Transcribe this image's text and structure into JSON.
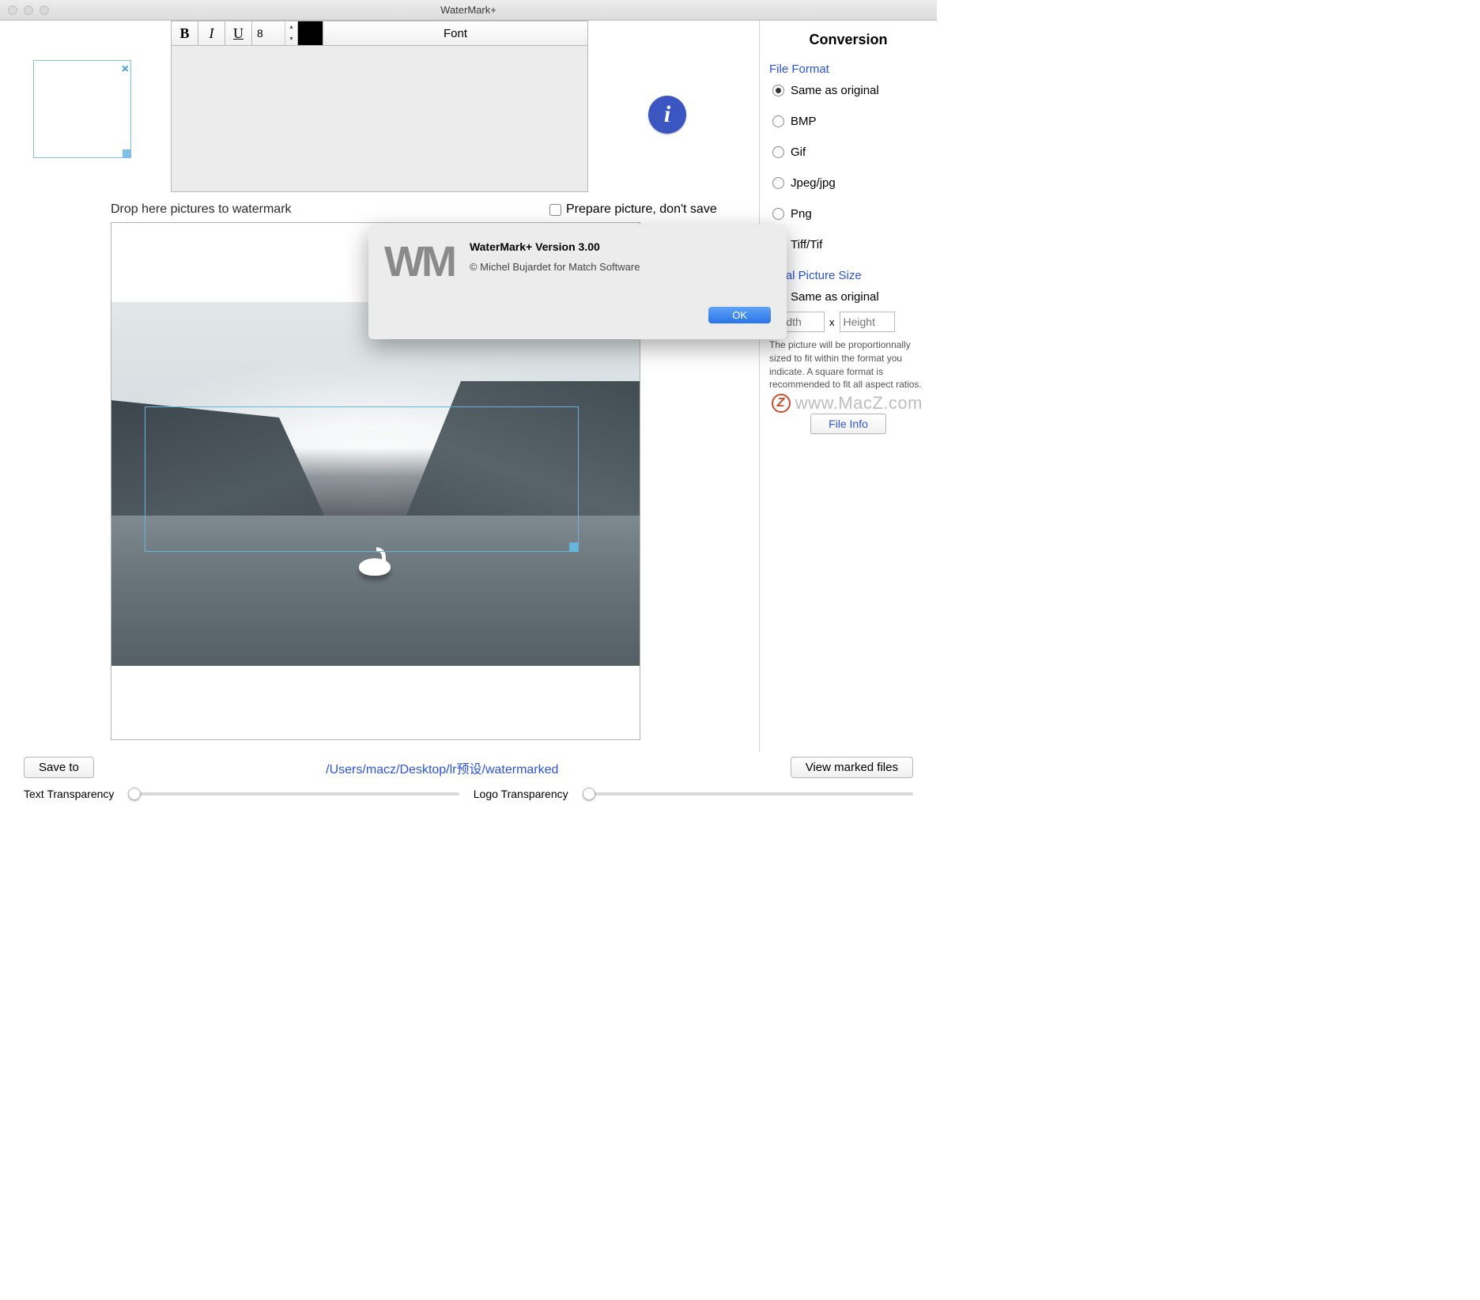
{
  "window": {
    "title": "WaterMark+"
  },
  "toolbar": {
    "bold": "B",
    "italic": "I",
    "underline": "U",
    "font_size": "8",
    "font_btn": "Font"
  },
  "main": {
    "drop_label": "Drop here pictures to watermark",
    "prepare_label": "Prepare picture, don't save"
  },
  "dialog": {
    "logo": "WM",
    "title": "WaterMark+ Version 3.00",
    "subtitle": "© Michel Bujardet for Match Software",
    "ok": "OK"
  },
  "sidebar": {
    "title": "Conversion",
    "file_format_label": "File Format",
    "formats": {
      "same": "Same as original",
      "bmp": "BMP",
      "gif": "Gif",
      "jpeg": "Jpeg/jpg",
      "png": "Png",
      "tiff": "Tiff/Tif"
    },
    "final_size_label": "Final Picture Size",
    "size_same": "Same as original",
    "width_ph": "Width",
    "height_ph": "Height",
    "x": "x",
    "help": "The picture will be proportionnally sized to fit within the format you indicate. A square format is recommended to fit all aspect ratios.",
    "file_info": "File Info"
  },
  "bottom": {
    "save_to": "Save to",
    "path": "/Users/macz/Desktop/lr预设/watermarked",
    "view_marked": "View marked files",
    "text_trans": "Text Transparency",
    "logo_trans": "Logo Transparency"
  },
  "overlay_site": "www.MacZ.com"
}
